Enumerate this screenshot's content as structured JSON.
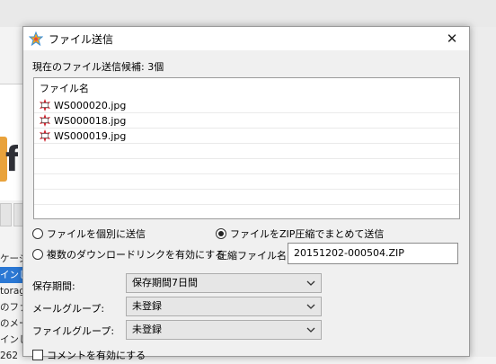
{
  "background": {
    "lines": [
      "ケージ",
      "インし",
      "torag",
      "のファ",
      "のメー",
      "インし",
      "262"
    ]
  },
  "dialog": {
    "title": "ファイル送信",
    "close_glyph": "✕",
    "count_line": "現在のファイル送信候補: 3個",
    "list": {
      "header": "ファイル名",
      "files": [
        "WS000020.jpg",
        "WS000018.jpg",
        "WS000019.jpg"
      ],
      "empty_rows": 5
    },
    "options": {
      "individual": "ファイルを個別に送信",
      "zip": "ファイルをZIP圧縮でまとめて送信",
      "download_link": "複数のダウンロードリンクを有効にする",
      "selected": "zip"
    },
    "zip_name_label": "圧縮ファイル名:",
    "zip_name_value": "20151202-000504.ZIP",
    "retention_label": "保存期間:",
    "retention_value": "保存期間7日間",
    "mail_group_label": "メールグループ:",
    "mail_group_value": "未登録",
    "file_group_label": "ファイルグループ:",
    "file_group_value": "未登録",
    "comment_checkbox": "コメントを有効にする"
  },
  "icons": {
    "app": "star-icon",
    "file": "image-file-icon"
  },
  "colors": {
    "selection": "#2b78d4",
    "file_icon": "#d0202a"
  }
}
